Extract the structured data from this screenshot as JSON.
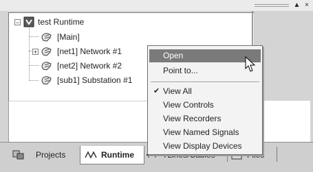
{
  "window": {
    "controls": [
      "▲",
      "×"
    ]
  },
  "tree": {
    "root": {
      "label": "test Runtime",
      "expander": "−"
    },
    "children": [
      {
        "label": "[Main]",
        "expander": ""
      },
      {
        "label": "[net1] Network #1",
        "expander": "+"
      },
      {
        "label": "[net2] Network #2",
        "expander": ""
      },
      {
        "label": "[sub1] Substation #1",
        "expander": ""
      }
    ]
  },
  "context_menu": {
    "items": [
      {
        "label": "Open",
        "highlighted": true
      },
      {
        "label": "Point to...",
        "highlighted": false
      },
      {
        "label": "View All",
        "checked": true
      },
      {
        "label": "View Controls"
      },
      {
        "label": "View Recorders"
      },
      {
        "label": "View Named Signals"
      },
      {
        "label": "View Display Devices"
      }
    ]
  },
  "tabs": [
    {
      "label": "Projects",
      "icon": "projects-icon"
    },
    {
      "label": "Runtime",
      "icon": "runtime-wave-icon",
      "active": true
    },
    {
      "label": "TLines/Cables",
      "icon": "tlines-icon"
    },
    {
      "label": "Files",
      "icon": "files-icon"
    }
  ],
  "colors": {
    "menu_highlight": "#7a7a7a",
    "panel_bg": "#ffffff",
    "chrome": "#d4d4d4"
  }
}
